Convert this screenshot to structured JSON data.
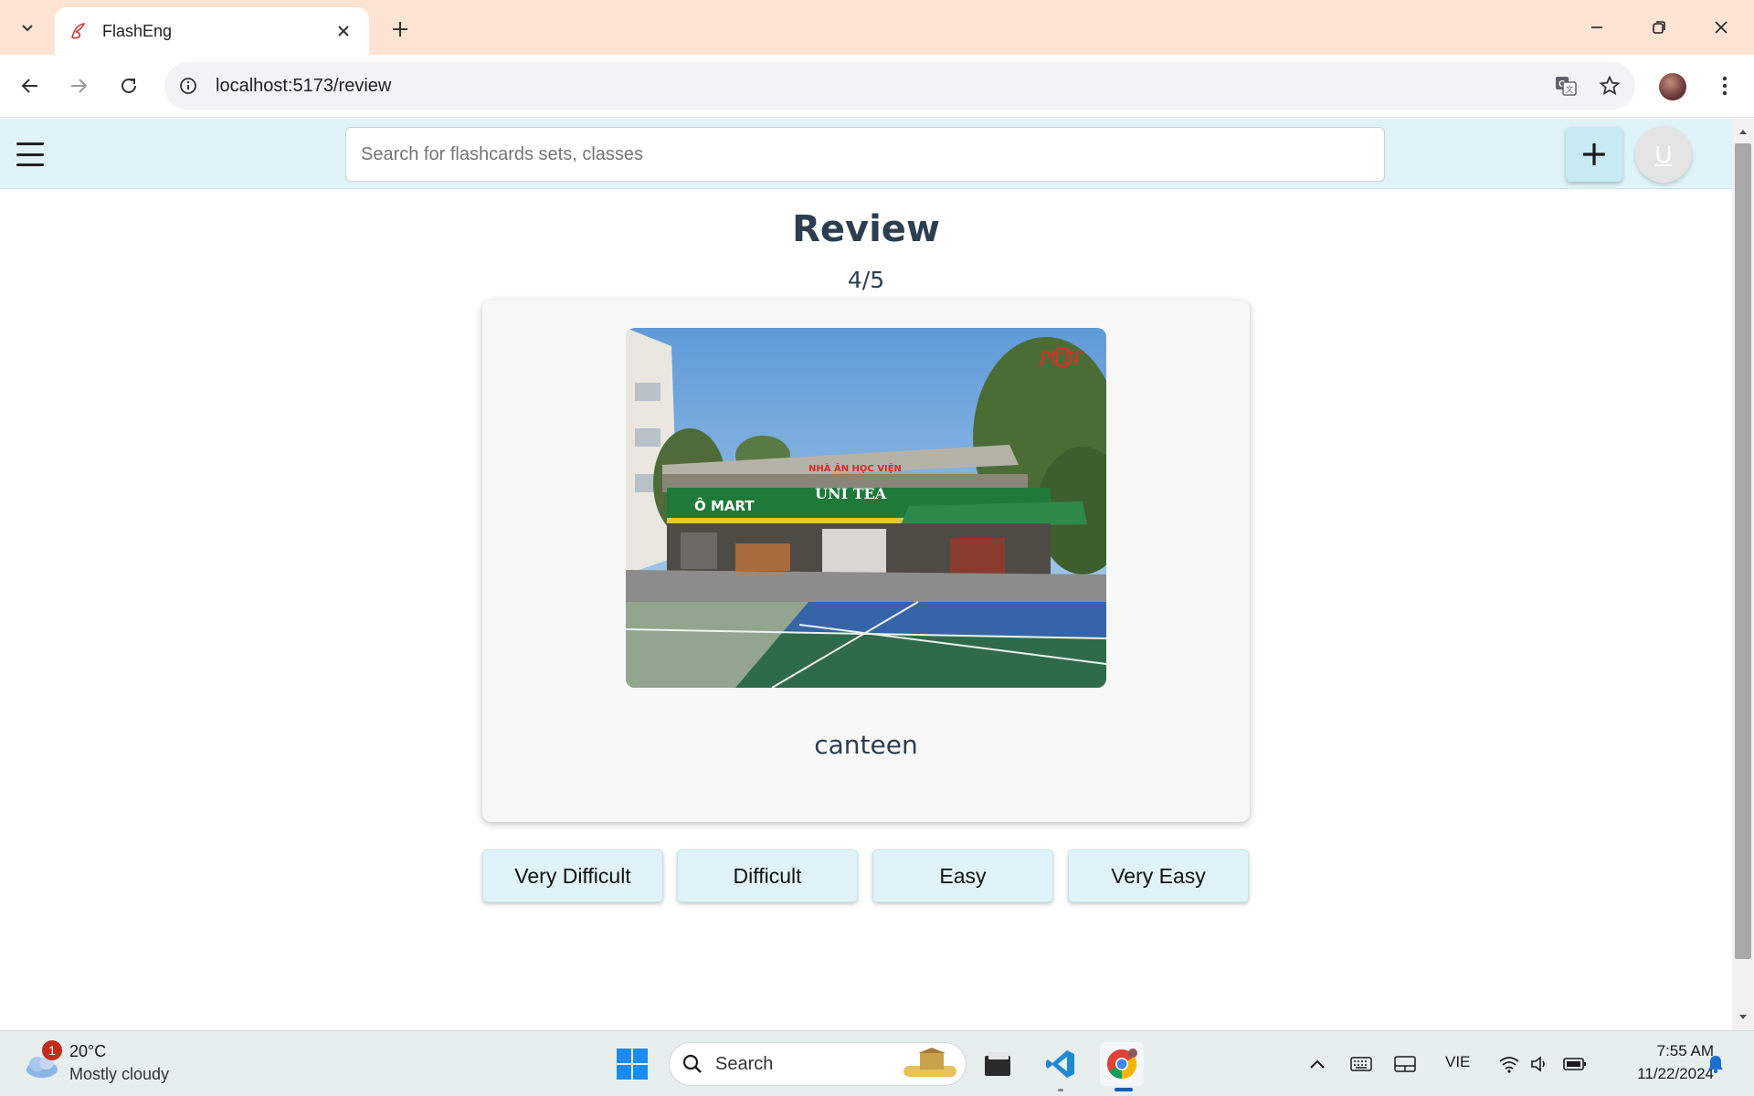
{
  "browser": {
    "tab_title": "FlashEng",
    "url": "localhost:5173/review"
  },
  "app": {
    "search_placeholder": "Search for flashcards sets, classes",
    "avatar_letter": "U"
  },
  "review": {
    "title": "Review",
    "progress": "4/5",
    "card_word": "canteen",
    "card_image": {
      "description_icon": "photo",
      "sign_text_main": "NHÀ ĂN HỌC VIỆN",
      "sign_text_store": "UNI TEA",
      "sign_text_mart": "Ô MART",
      "watermark_text": "PTIT"
    },
    "buttons": [
      {
        "label": "Very Difficult"
      },
      {
        "label": "Difficult"
      },
      {
        "label": "Easy"
      },
      {
        "label": "Very Easy"
      }
    ]
  },
  "taskbar": {
    "weather_badge": "1",
    "weather_temp": "20°C",
    "weather_desc": "Mostly cloudy",
    "search_label": "Search",
    "language": "VIE",
    "time": "7:55 AM",
    "date": "11/22/2024"
  },
  "colors": {
    "app_header_bg": "#dff3f8",
    "button_bg": "#dff3f8",
    "title_text": "#2c3e50",
    "tabstrip_bg": "#fde3d3"
  }
}
